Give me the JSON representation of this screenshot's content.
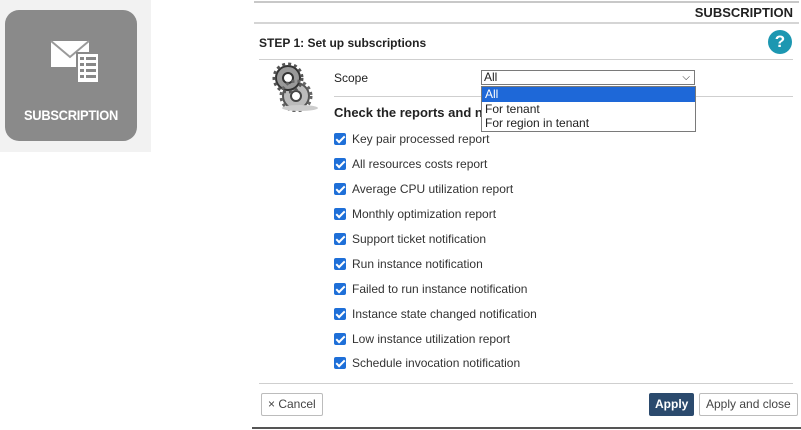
{
  "tile": {
    "label": "SUBSCRIPTION",
    "icon": "mail-form-icon"
  },
  "panel": {
    "title": "SUBSCRIPTION",
    "step": "STEP 1:  Set up subscriptions",
    "help_icon": "?",
    "scope": {
      "label": "Scope",
      "selected": "All",
      "options": [
        "All",
        "For tenant",
        "For region in tenant"
      ]
    },
    "check_heading": "Check the reports and not",
    "checks": [
      {
        "label": "Key pair processed report",
        "checked": true
      },
      {
        "label": "All resources costs report",
        "checked": true
      },
      {
        "label": "Average CPU utilization report",
        "checked": true
      },
      {
        "label": "Monthly optimization report",
        "checked": true
      },
      {
        "label": "Support ticket notification",
        "checked": true
      },
      {
        "label": "Run instance notification",
        "checked": true
      },
      {
        "label": "Failed to run instance notification",
        "checked": true
      },
      {
        "label": "Instance state changed notification",
        "checked": true
      },
      {
        "label": "Low instance utilization report",
        "checked": true
      },
      {
        "label": "Schedule invocation notification",
        "checked": true
      }
    ],
    "buttons": {
      "cancel": "× Cancel",
      "apply": "Apply",
      "apply_close": "Apply and close"
    }
  },
  "colors": {
    "tile_bg": "#8a8a8a",
    "help": "#1c97b1",
    "checkbox": "#1e6fd8",
    "apply": "#2b4a6d",
    "dropdown_selected": "#1e68d8"
  }
}
